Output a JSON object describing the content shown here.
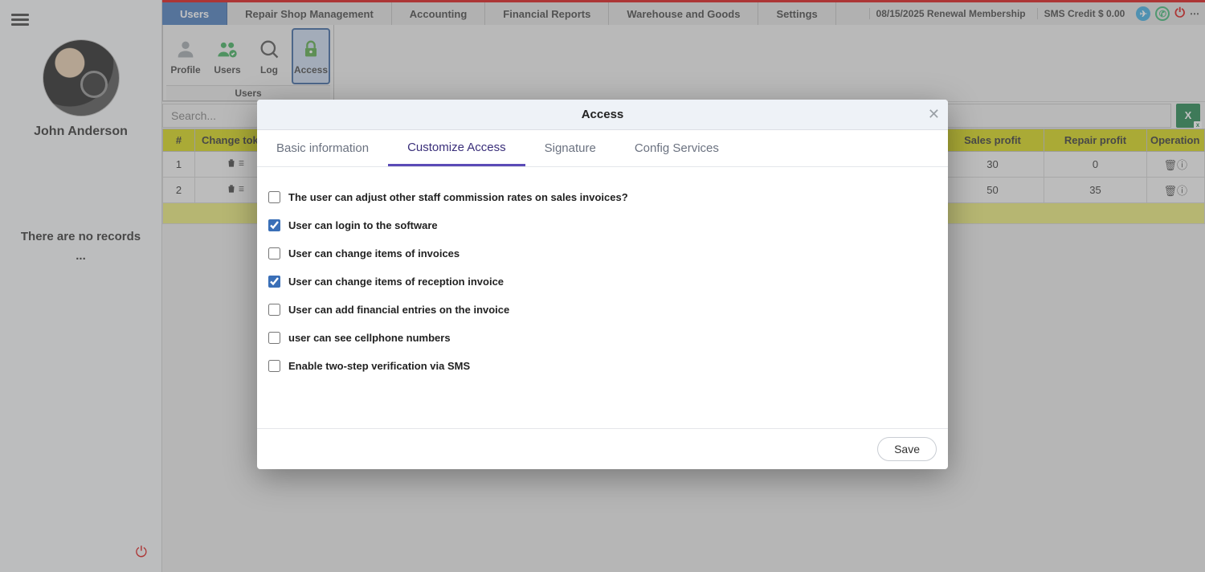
{
  "sidebar": {
    "username": "John Anderson",
    "no_records_line1": "There are no records",
    "no_records_line2": "..."
  },
  "topTabs": [
    "Users",
    "Repair Shop Management",
    "Accounting",
    "Financial Reports",
    "Warehouse and Goods",
    "Settings"
  ],
  "topActiveIndex": 0,
  "topRight": {
    "renewal": "08/15/2025 Renewal Membership",
    "sms_credit_label": "SMS Credit $ 0.00"
  },
  "toolbar": {
    "items": [
      {
        "id": "profile",
        "label": "Profile"
      },
      {
        "id": "users",
        "label": "Users"
      },
      {
        "id": "log",
        "label": "Log"
      },
      {
        "id": "access",
        "label": "Access"
      }
    ],
    "activeId": "access",
    "groupTitle": "Users"
  },
  "search": {
    "placeholder": "Search..."
  },
  "grid": {
    "headers": [
      "#",
      "Change tok",
      "Sales profit",
      "Repair profit",
      "Operation"
    ],
    "rows": [
      {
        "num": "1",
        "sales_profit": "30",
        "repair_profit": "0"
      },
      {
        "num": "2",
        "sales_profit": "50",
        "repair_profit": "35"
      }
    ]
  },
  "modal": {
    "title": "Access",
    "tabs": [
      "Basic information",
      "Customize Access",
      "Signature",
      "Config Services"
    ],
    "activeTabIndex": 1,
    "permissions": [
      {
        "label": "The user can adjust other staff commission rates on sales invoices?",
        "checked": false
      },
      {
        "label": "User can login to the software",
        "checked": true
      },
      {
        "label": "User can change items of invoices",
        "checked": false
      },
      {
        "label": "User can change items of reception invoice",
        "checked": true
      },
      {
        "label": "User can add financial entries on the invoice",
        "checked": false
      },
      {
        "label": "user can see cellphone numbers",
        "checked": false
      },
      {
        "label": "Enable two-step verification via SMS",
        "checked": false
      }
    ],
    "save_label": "Save"
  }
}
